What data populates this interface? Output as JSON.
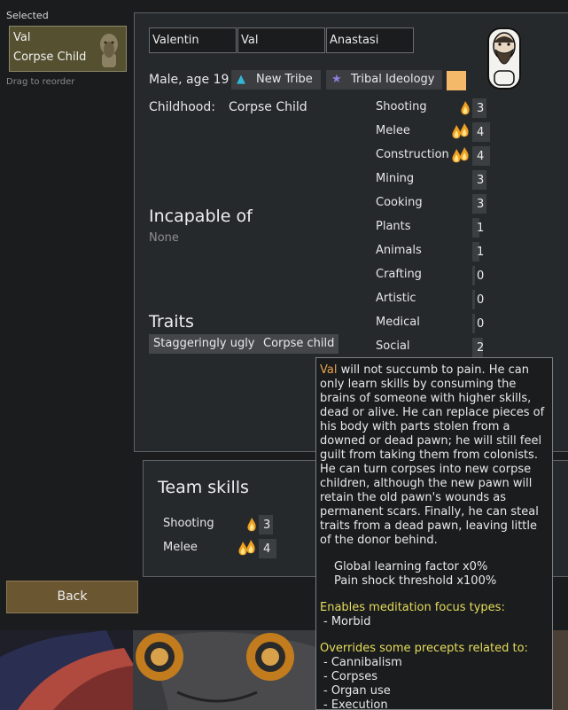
{
  "left": {
    "selected_label": "Selected",
    "pawn": {
      "name": "Val",
      "subtitle": "Corpse Child"
    },
    "drag_hint": "Drag to reorder",
    "back_label": "Back"
  },
  "pawn": {
    "first_name": "Valentin",
    "nickname": "Val",
    "last_name": "Anastasi",
    "gender_age": "Male, age 19",
    "faction": "New Tribe",
    "ideology": "Tribal Ideology",
    "favorite_color": "#f5b96a",
    "childhood_label": "Childhood:",
    "childhood_value": "Corpse Child",
    "incapable_title": "Incapable of",
    "incapable_value": "None",
    "traits_title": "Traits",
    "traits": [
      "Staggeringly ugly",
      "Corpse child"
    ]
  },
  "skills": [
    {
      "name": "Shooting",
      "level": "3",
      "passion": 1
    },
    {
      "name": "Melee",
      "level": "4",
      "passion": 2
    },
    {
      "name": "Construction",
      "level": "4",
      "passion": 2
    },
    {
      "name": "Mining",
      "level": "3",
      "passion": 0
    },
    {
      "name": "Cooking",
      "level": "3",
      "passion": 0
    },
    {
      "name": "Plants",
      "level": "1",
      "passion": 0
    },
    {
      "name": "Animals",
      "level": "1",
      "passion": 0
    },
    {
      "name": "Crafting",
      "level": "0",
      "passion": 0
    },
    {
      "name": "Artistic",
      "level": "0",
      "passion": 0
    },
    {
      "name": "Medical",
      "level": "0",
      "passion": 0
    },
    {
      "name": "Social",
      "level": "2",
      "passion": 0
    }
  ],
  "team": {
    "title": "Team skills",
    "skills": [
      {
        "name": "Shooting",
        "level": "3",
        "passion": 1
      },
      {
        "name": "Melee",
        "level": "4",
        "passion": 2
      }
    ]
  },
  "tooltip": {
    "name": "Val",
    "description": " will not succumb to pain. He can only learn skills by consuming the brains of someone with higher skills, dead or alive. He can replace pieces of his body with parts stolen from a downed or dead pawn; he will still feel guilt from taking them from colonists. He can turn corpses into new corpse children, although the new pawn will retain the old pawn's wounds as permanent scars. Finally, he can steal traits from a dead pawn, leaving little of the donor behind.",
    "stat1": "Global learning factor x0%",
    "stat2": "Pain shock threshold x100%",
    "meditation_header": "Enables meditation focus types:",
    "meditation_items": [
      "- Morbid"
    ],
    "precepts_header": "Overrides some precepts related to:",
    "precepts_items": [
      "- Cannibalism",
      "- Corpses",
      "- Organ use",
      "- Execution"
    ]
  }
}
